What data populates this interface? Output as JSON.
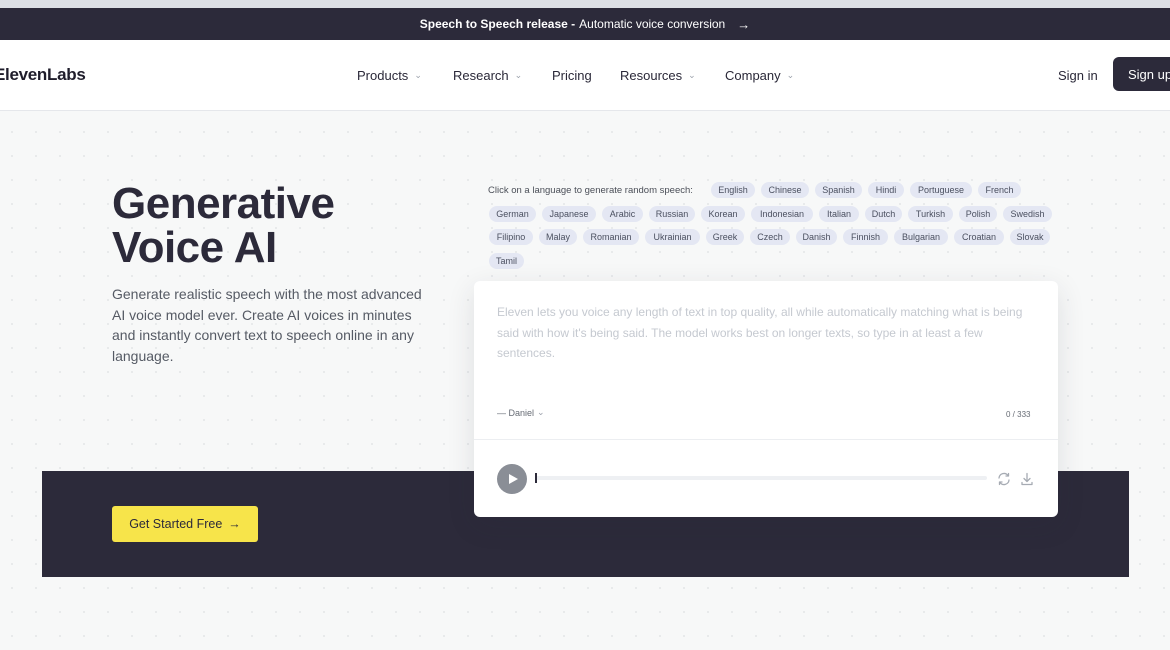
{
  "announcement": {
    "bold": "Speech to Speech release -",
    "text": "Automatic voice conversion",
    "arrow": "→"
  },
  "nav": {
    "logo": "ElevenLabs",
    "items": [
      {
        "label": "Products",
        "dropdown": true
      },
      {
        "label": "Research",
        "dropdown": true
      },
      {
        "label": "Pricing",
        "dropdown": false
      },
      {
        "label": "Resources",
        "dropdown": true
      },
      {
        "label": "Company",
        "dropdown": true
      }
    ],
    "sign_in": "Sign in",
    "sign_up": "Sign up"
  },
  "hero": {
    "title_line1": "Generative",
    "title_line2": "Voice AI",
    "description": "Generate realistic speech with the most advanced AI voice model ever. Create AI voices in minutes and instantly convert text to speech online in any language.",
    "cta": "Get Started Free",
    "cta_arrow": "→"
  },
  "demo": {
    "prompt": "Click on a language to generate random speech:",
    "languages": [
      "English",
      "Chinese",
      "Spanish",
      "Hindi",
      "Portuguese",
      "French",
      "German",
      "Japanese",
      "Arabic",
      "Russian",
      "Korean",
      "Indonesian",
      "Italian",
      "Dutch",
      "Turkish",
      "Polish",
      "Swedish",
      "Filipino",
      "Malay",
      "Romanian",
      "Ukrainian",
      "Greek",
      "Czech",
      "Danish",
      "Finnish",
      "Bulgarian",
      "Croatian",
      "Slovak",
      "Tamil"
    ],
    "placeholder": "Eleven lets you voice any length of text in top quality, all while automatically matching what is being said with how it's being said. The model works best on longer texts, so type in at least a few sentences.",
    "voice": "— Daniel",
    "char_count": "0 / 333",
    "progress": 0
  },
  "colors": {
    "dark": "#2c2a3a",
    "cta": "#f7e44a",
    "chip": "#e4e7f3"
  },
  "icons": [
    "arrow-right-icon",
    "chevron-down-icon",
    "play-icon",
    "regenerate-icon",
    "download-icon"
  ]
}
